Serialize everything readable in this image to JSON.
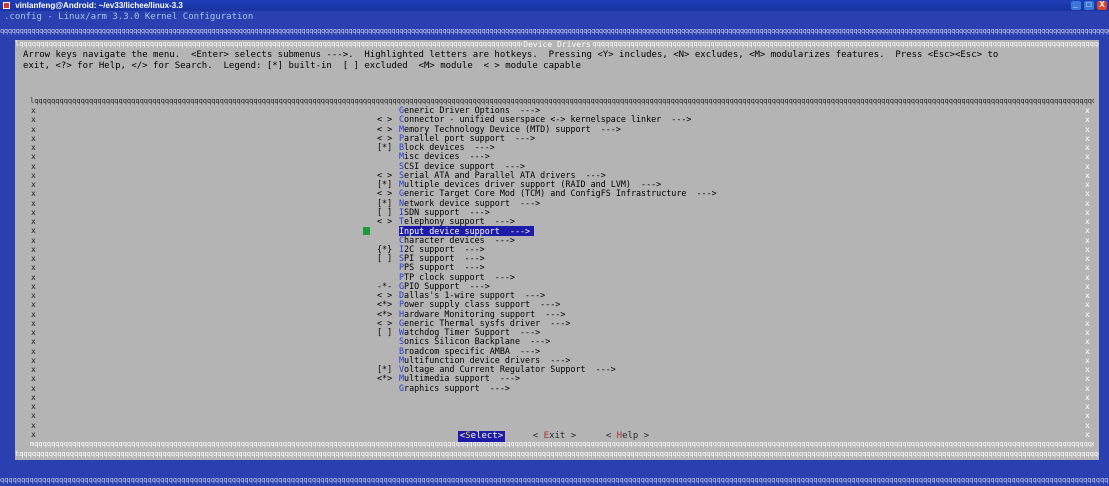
{
  "window": {
    "title": "vinlanfeng@Android: ~/ev33/lichee/linux-3.3",
    "buttons": [
      "_",
      "□",
      "X"
    ]
  },
  "config_title": ".config - Linux/arm 3.3.0 Kernel Configuration",
  "dialog": {
    "title": "Device Drivers",
    "help_line1": "Arrow keys navigate the menu.  <Enter> selects submenus --->.  Highlighted letters are hotkeys.  Pressing <Y> includes, <N> excludes, <M> modularizes features.  Press <Esc><Esc> to",
    "help_line2": "exit, <?> for Help, </> for Search.  Legend: [*] built-in  [ ] excluded  <M> module  < > module capable"
  },
  "menu": {
    "items": [
      {
        "mark": "",
        "hot": "G",
        "rest": "eneric Driver Options  --->"
      },
      {
        "mark": "< >",
        "hot": "C",
        "rest": "onnector - unified userspace <-> kernelspace linker  --->"
      },
      {
        "mark": "< >",
        "hot": "M",
        "rest": "emory Technology Device (MTD) support  --->"
      },
      {
        "mark": "< >",
        "hot": "P",
        "rest": "arallel port support  --->"
      },
      {
        "mark": "[*]",
        "hot": "B",
        "rest": "lock devices  --->"
      },
      {
        "mark": "",
        "hot": "M",
        "rest": "isc devices  --->"
      },
      {
        "mark": "",
        "hot": "S",
        "rest": "CSI device support  --->"
      },
      {
        "mark": "< >",
        "hot": "S",
        "rest": "erial ATA and Parallel ATA drivers  --->"
      },
      {
        "mark": "[*]",
        "hot": "M",
        "rest": "ultiple devices driver support (RAID and LVM)  --->"
      },
      {
        "mark": "< >",
        "hot": "G",
        "rest": "eneric Target Core Mod (TCM) and ConfigFS Infrastructure  --->"
      },
      {
        "mark": "[*]",
        "hot": "N",
        "rest": "etwork device support  --->"
      },
      {
        "mark": "[ ]",
        "hot": "I",
        "rest": "SDN support  --->"
      },
      {
        "mark": "< >",
        "hot": "T",
        "rest": "elephony support  --->"
      },
      {
        "mark": "",
        "hot": "I",
        "rest": "nput device support  --->"
      },
      {
        "mark": "",
        "hot": "C",
        "rest": "haracter devices  --->"
      },
      {
        "mark": "{*}",
        "hot": "I",
        "rest": "2C support  --->"
      },
      {
        "mark": "[ ]",
        "hot": "S",
        "rest": "PI support  --->"
      },
      {
        "mark": "",
        "hot": "P",
        "rest": "PS support  --->"
      },
      {
        "mark": "",
        "hot": "P",
        "rest": "TP clock support  --->"
      },
      {
        "mark": "-*-",
        "hot": "G",
        "rest": "PIO Support  --->"
      },
      {
        "mark": "< >",
        "hot": "D",
        "rest": "allas's 1-wire support  --->"
      },
      {
        "mark": "<*>",
        "hot": "P",
        "rest": "ower supply class support  --->"
      },
      {
        "mark": "<*>",
        "hot": "H",
        "rest": "ardware Monitoring support  --->"
      },
      {
        "mark": "< >",
        "hot": "G",
        "rest": "eneric Thermal sysfs driver  --->"
      },
      {
        "mark": "[ ]",
        "hot": "W",
        "rest": "atchdog Timer Support  --->"
      },
      {
        "mark": "",
        "hot": "S",
        "rest": "onics Silicon Backplane  --->"
      },
      {
        "mark": "",
        "hot": "B",
        "rest": "roadcom specific AMBA  --->"
      },
      {
        "mark": "",
        "hot": "M",
        "rest": "ultifunction device drivers  --->"
      },
      {
        "mark": "[*]",
        "hot": "V",
        "rest": "oltage and Current Regulator Support  --->"
      },
      {
        "mark": "<*>",
        "hot": "M",
        "rest": "ultimedia support  --->"
      },
      {
        "mark": "",
        "hot": "G",
        "rest": "raphics support  --->"
      }
    ],
    "selected_index": 13
  },
  "buttons": {
    "select": {
      "open": "<",
      "hot": "S",
      "rest": "elect",
      "close": ">"
    },
    "exit": {
      "open": "< ",
      "hot": "E",
      "rest": "xit",
      "close": " >"
    },
    "help": {
      "open": "< ",
      "hot": "H",
      "rest": "elp",
      "close": " >"
    }
  }
}
